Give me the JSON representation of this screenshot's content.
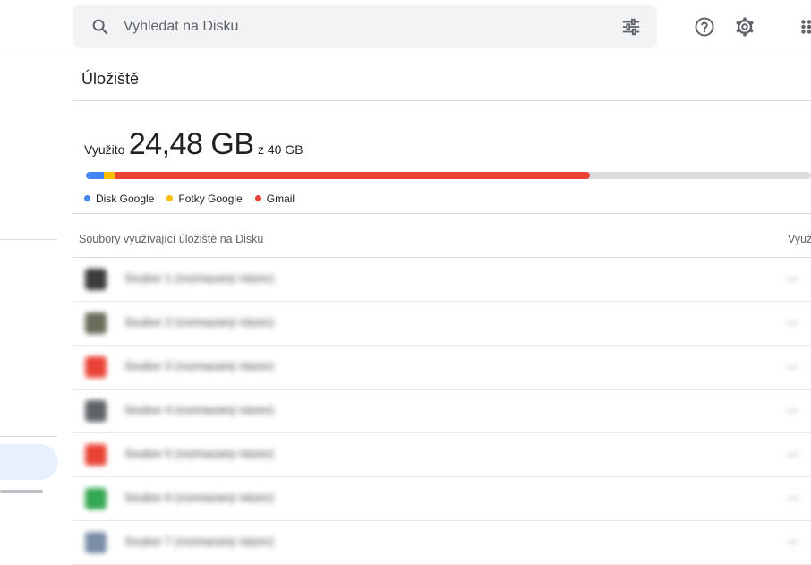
{
  "search": {
    "placeholder": "Vyhledat na Disku"
  },
  "header": {
    "icons": [
      "search-icon",
      "filter-icon",
      "help-icon",
      "settings-icon",
      "apps-icon"
    ]
  },
  "page": {
    "title": "Úložiště"
  },
  "usage": {
    "used_label": "Využito",
    "used_value": "24,48 GB",
    "total_label": "z 40 GB",
    "fractions": {
      "disk": 0.025,
      "photos": 0.016,
      "gmail": 0.654
    },
    "colors": {
      "disk": "#4285f4",
      "photos": "#fbbc04",
      "gmail": "#ea4335",
      "free": "#dadce0"
    }
  },
  "legend": [
    {
      "label": "Disk Google",
      "color": "#4285f4"
    },
    {
      "label": "Fotky Google",
      "color": "#fbbc04"
    },
    {
      "label": "Gmail",
      "color": "#ea4335"
    }
  ],
  "files_section": {
    "header": "Soubory využívající úložiště na Disku",
    "size_header": "Využ",
    "rows": [
      {
        "name": "Soubor 1 (rozmazaný název)",
        "size": "—",
        "icon_color": "#3c3c3c"
      },
      {
        "name": "Soubor 2 (rozmazaný název)",
        "size": "—",
        "icon_color": "#6b6b5a"
      },
      {
        "name": "Soubor 3 (rozmazaný název)",
        "size": "—",
        "icon_color": "#ea4335"
      },
      {
        "name": "Soubor 4 (rozmazaný název)",
        "size": "—",
        "icon_color": "#5f6368"
      },
      {
        "name": "Soubor 5 (rozmazaný název)",
        "size": "—",
        "icon_color": "#ea4335"
      },
      {
        "name": "Soubor 6 (rozmazaný název)",
        "size": "—",
        "icon_color": "#34a853"
      },
      {
        "name": "Soubor 7 (rozmazaný název)",
        "size": "—",
        "icon_color": "#7b8ea8"
      }
    ]
  }
}
